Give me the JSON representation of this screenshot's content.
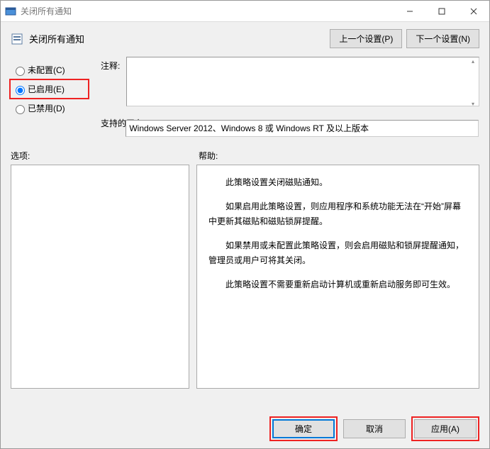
{
  "window": {
    "title": "关闭所有通知"
  },
  "header": {
    "title": "关闭所有通知",
    "prev_btn": "上一个设置(P)",
    "next_btn": "下一个设置(N)"
  },
  "radios": {
    "not_configured": "未配置(C)",
    "enabled": "已启用(E)",
    "disabled": "已禁用(D)",
    "selected": "enabled"
  },
  "labels": {
    "comment": "注释:",
    "platform": "支持的平台:",
    "options": "选项:",
    "help": "帮助:"
  },
  "fields": {
    "comment": "",
    "platform": "Windows Server 2012、Windows 8 或 Windows RT 及以上版本"
  },
  "help": {
    "p1": "此策略设置关闭磁贴通知。",
    "p2": "如果启用此策略设置，则应用程序和系统功能无法在“开始”屏幕中更新其磁贴和磁贴锁屏提醒。",
    "p3": "如果禁用或未配置此策略设置，则会启用磁贴和锁屏提醒通知，管理员或用户可将其关闭。",
    "p4": "此策略设置不需要重新启动计算机或重新启动服务即可生效。"
  },
  "footer": {
    "ok": "确定",
    "cancel": "取消",
    "apply": "应用(A)"
  }
}
